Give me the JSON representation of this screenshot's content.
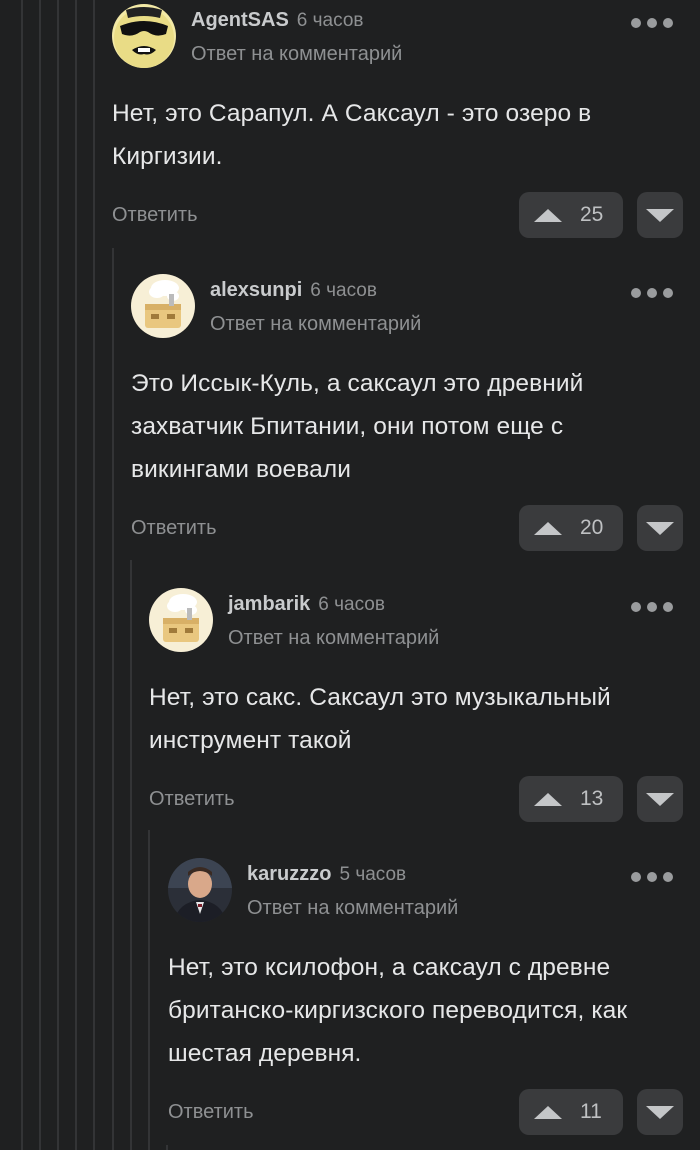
{
  "comments": [
    {
      "author": "AgentSAS",
      "time": "6 часов",
      "reply_to": "Ответ на комментарий",
      "text": "Нет, это Сарапул. А Саксаул - это озеро в Киргизии.",
      "reply_label": "Ответить",
      "votes": "25"
    },
    {
      "author": "alexsunpi",
      "time": "6 часов",
      "reply_to": "Ответ на комментарий",
      "text": "Это Иссык-Куль, а саксаул это древний захватчик Бпитании, они потом еще с викингами воевали",
      "reply_label": "Ответить",
      "votes": "20"
    },
    {
      "author": "jambarik",
      "time": "6 часов",
      "reply_to": "Ответ на комментарий",
      "text": "Нет, это сакс. Саксаул это музыкальный инструмент такой",
      "reply_label": "Ответить",
      "votes": "13"
    },
    {
      "author": "karuzzzo",
      "time": "5 часов",
      "reply_to": "Ответ на комментарий",
      "text": "Нет, это ксилофон, а саксаул с древне британско-киргизского переводится, как шестая деревня.",
      "reply_label": "Ответить",
      "votes": "11"
    }
  ],
  "icons": {
    "more": "more-dots-icon",
    "upvote": "triangle-up-icon",
    "downvote": "triangle-down-icon"
  },
  "colors": {
    "background": "#1f2021",
    "button_bg": "#3a3b3d",
    "muted_text": "#8e9092"
  }
}
